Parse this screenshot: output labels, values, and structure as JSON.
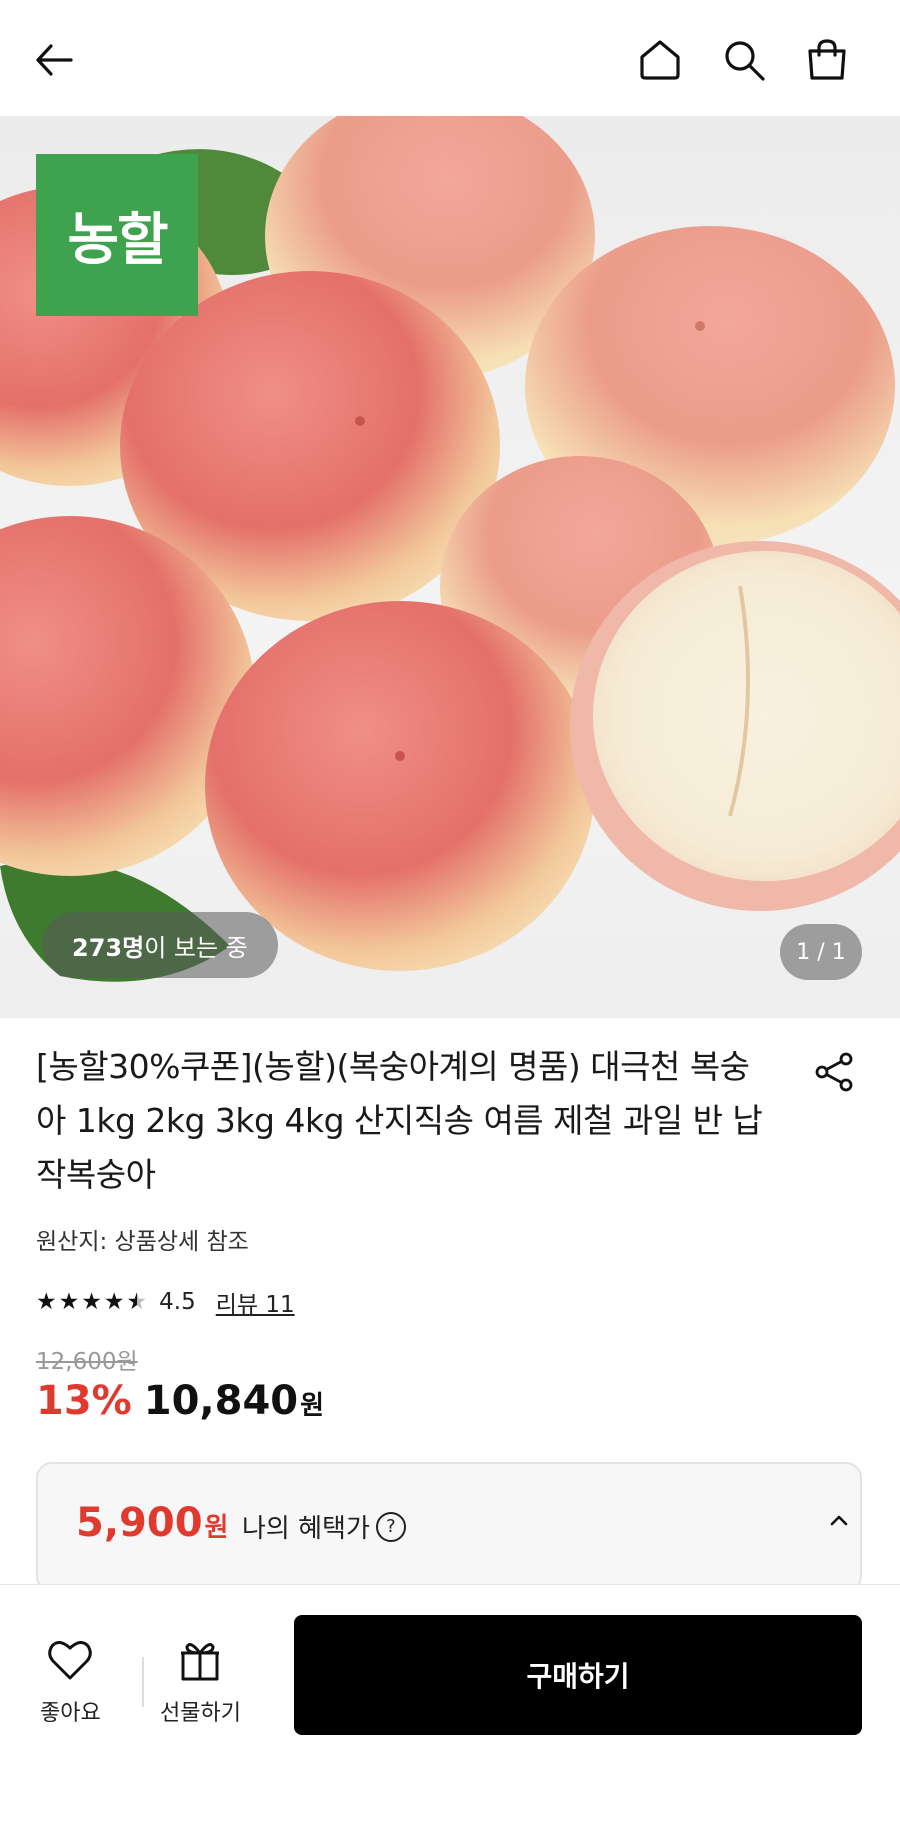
{
  "header": {
    "back_icon": "arrow-left-icon",
    "home_icon": "home-icon",
    "search_icon": "search-icon",
    "cart_icon": "shopping-bag-icon"
  },
  "hero": {
    "brand_badge": "농할",
    "viewers_count": "273명",
    "viewers_suffix": "이 보는 중",
    "page_indicator": "1 / 1"
  },
  "product": {
    "title": "[농할30%쿠폰](농할)(복숭아계의 명품) 대극천 복숭아 1kg 2kg 3kg 4kg 산지직송 여름 제철 과일 반 납작복숭아",
    "origin": "원산지: 상품상세 참조",
    "rating_stars": 4.5,
    "rating_value": "4.5",
    "review_label": "리뷰 11",
    "original_price": "12,600원",
    "discount_rate": "13%",
    "sale_price": "10,840",
    "currency": "원"
  },
  "benefit": {
    "price": "5,900",
    "currency": "원",
    "label": "나의 혜택가",
    "help_glyph": "?"
  },
  "bottom_bar": {
    "like_label": "좋아요",
    "gift_label": "선물하기",
    "buy_label": "구매하기"
  },
  "colors": {
    "accent_red": "#e03a2f",
    "brand_green": "#3fa24f",
    "buy_button": "#000000"
  }
}
